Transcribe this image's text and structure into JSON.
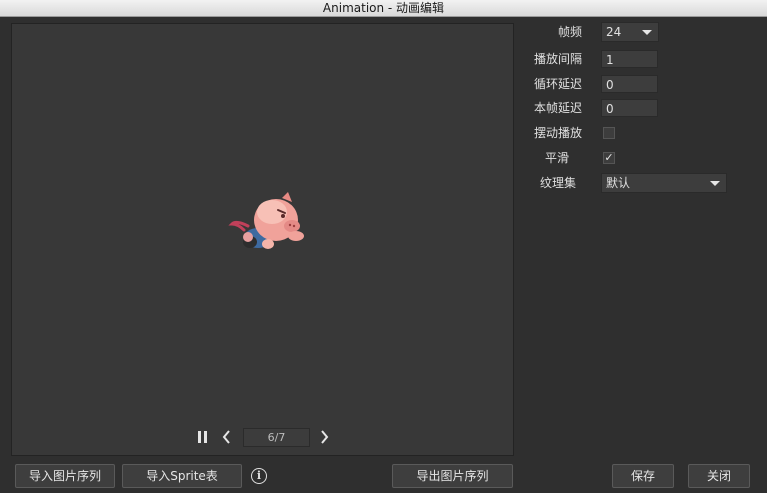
{
  "window": {
    "title": "Animation - 动画编辑"
  },
  "player": {
    "pause_icon": "pause-icon",
    "prev_icon": "chevron-left-icon",
    "next_icon": "chevron-right-icon",
    "frame_counter": "6/7"
  },
  "properties": {
    "fps": {
      "label": "帧频",
      "value": "24"
    },
    "interval": {
      "label": "播放间隔",
      "value": "1"
    },
    "loop_delay": {
      "label": "循环延迟",
      "value": "0"
    },
    "frame_delay": {
      "label": "本帧延迟",
      "value": "0"
    },
    "swing": {
      "label": "摆动播放",
      "checked": false
    },
    "smooth": {
      "label": "平滑",
      "checked": true,
      "mark": "✓"
    },
    "atlas": {
      "label": "纹理集",
      "value": "默认"
    }
  },
  "buttons": {
    "import_sequence": "导入图片序列",
    "import_sprite": "导入Sprite表",
    "info_glyph": "i",
    "export_sequence": "导出图片序列",
    "save": "保存",
    "close": "关闭"
  }
}
